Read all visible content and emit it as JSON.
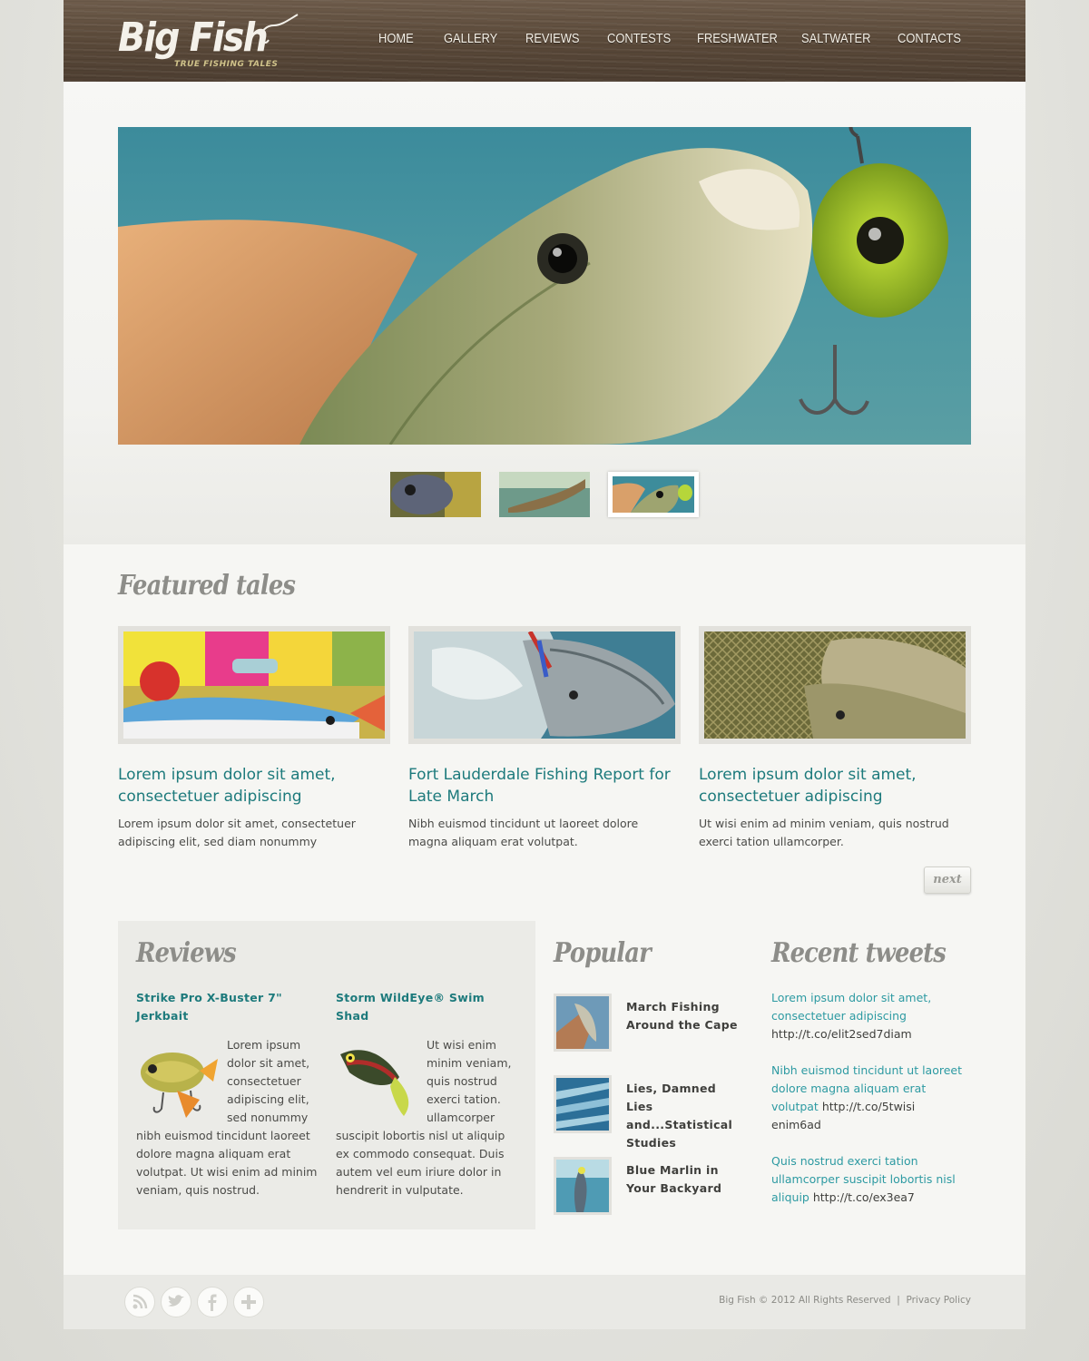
{
  "header": {
    "logo_title": "Big Fish",
    "logo_tagline": "TRUE FISHING TALES",
    "nav": [
      "HOME",
      "GALLERY",
      "REVIEWS",
      "CONTESTS",
      "FRESHWATER",
      "SALTWATER",
      "CONTACTS"
    ]
  },
  "slider": {
    "active_thumb": 3,
    "thumb_count": 3
  },
  "featured": {
    "title": "Featured tales",
    "items": [
      {
        "title": "Lorem ipsum dolor sit amet, consectetuer adipiscing",
        "text": "Lorem ipsum dolor sit amet, consectetuer adipiscing elit, sed diam nonummy"
      },
      {
        "title": "Fort Lauderdale Fishing Report for Late March",
        "text": "Nibh euismod tincidunt ut laoreet dolore magna aliquam erat volutpat."
      },
      {
        "title": "Lorem ipsum dolor sit amet, consectetuer adipiscing",
        "text": "Ut wisi enim ad minim veniam, quis nostrud exerci tation ullamcorper."
      }
    ],
    "next_label": "next"
  },
  "reviews": {
    "title": "Reviews",
    "items": [
      {
        "title": "Strike Pro X-Buster 7\" Jerkbait",
        "text": "Lorem ipsum dolor sit amet, consectetuer adipiscing elit, sed nonummy nibh euismod tincidunt laoreet dolore magna aliquam erat volutpat. Ut wisi enim ad minim veniam, quis nostrud."
      },
      {
        "title": "Storm WildEye® Swim Shad",
        "text": "Ut wisi enim minim veniam, quis nostrud exerci tation. ullamcorper suscipit lobortis nisl ut aliquip ex commodo consequat. Duis autem vel eum iriure dolor in hendrerit in vulputate."
      }
    ]
  },
  "popular": {
    "title": "Popular",
    "items": [
      {
        "title": "March Fishing Around the Cape"
      },
      {
        "title": "Lies, Damned Lies and...Statistical Studies"
      },
      {
        "title": "Blue Marlin in Your Backyard"
      }
    ]
  },
  "tweets": {
    "title": "Recent tweets",
    "items": [
      {
        "text": "Lorem ipsum dolor sit amet, consectetuer adipiscing",
        "link": "http://t.co/elit2sed7diam"
      },
      {
        "text": "Nibh euismod tincidunt ut laoreet dolore magna aliquam erat volutpat",
        "link": "http://t.co/5twisi enim6ad"
      },
      {
        "text": "Quis nostrud exerci tation ullamcorper suscipit lobortis nisl aliquip",
        "link": "http://t.co/ex3ea7"
      }
    ]
  },
  "footer": {
    "copyright": "Big Fish © 2012 All Rights Reserved",
    "separator": "|",
    "privacy": "Privacy Policy",
    "social_icons": [
      "rss-icon",
      "twitter-icon",
      "facebook-icon",
      "plus-icon"
    ]
  },
  "colors": {
    "accent": "#1d7a7c",
    "tweet_link": "#2d9aa2",
    "heading_gray": "#8d8d89"
  }
}
